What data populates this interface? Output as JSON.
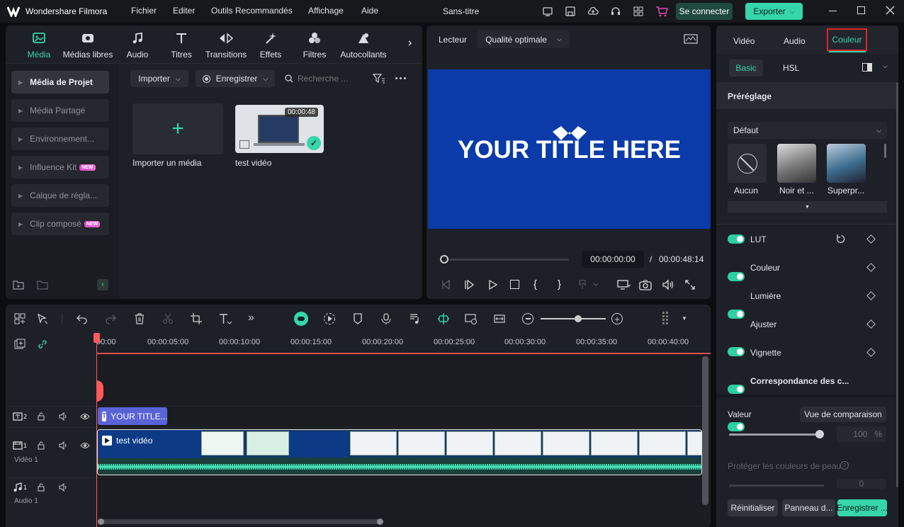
{
  "app": {
    "title": "Wondershare Filmora",
    "project_title": "Sans-titre",
    "login_label": "Se connecter",
    "export_label": "Exporter"
  },
  "menu": [
    "Fichier",
    "Editer",
    "Outils Recommandés",
    "Affichage",
    "Aide"
  ],
  "media_tabs": [
    "Média",
    "Médias libres",
    "Audio",
    "Titres",
    "Transitions",
    "Effets",
    "Filtres",
    "Autocollants"
  ],
  "sidebar": {
    "items": [
      {
        "label": "Média de Projet"
      },
      {
        "label": "Média Partagé"
      },
      {
        "label": "Environnement..."
      },
      {
        "label": "Influence Kit",
        "badge": "NEW"
      },
      {
        "label": "Calque de régla..."
      },
      {
        "label": "Clip composé",
        "badge": "NEW"
      }
    ]
  },
  "media_toolbar": {
    "import_label": "Importer",
    "record_label": "Enregistrer",
    "search_placeholder": "Recherche ..."
  },
  "media_items": [
    {
      "label": "Importer un média"
    },
    {
      "label": "test vidéo",
      "duration": "00:00:48"
    }
  ],
  "player": {
    "label": "Lecteur",
    "quality": "Qualité optimale",
    "preview_title": "YOUR TITLE HERE",
    "current_time": "00:00:00:00",
    "separator": "/",
    "total_time": "00:00:48:14",
    "bracket_open": "{",
    "bracket_close": "}"
  },
  "right_panel": {
    "tabs": [
      "Vidéo",
      "Audio",
      "Couleur"
    ],
    "subtabs": [
      "Basic",
      "HSL"
    ],
    "preset_title": "Préréglage",
    "preset_select": "Défaut",
    "presets": [
      "Aucun",
      "Noir et ...",
      "Superpr..."
    ],
    "toggles": [
      "LUT",
      "Couleur",
      "Lumière",
      "Ajuster",
      "Vignette",
      "Correspondance des c..."
    ],
    "value_label": "Valeur",
    "compare_label": "Vue de comparaison",
    "value": "100",
    "value_unit": "%",
    "skin_label": "Protéger les couleurs de peau",
    "skin_value": "0",
    "buttons": {
      "reset": "Réinitialiser",
      "panel": "Panneau d...",
      "save": "Enregistrer ..."
    }
  },
  "timeline": {
    "ruler": [
      "00:00",
      "00:00:05:00",
      "00:00:10:00",
      "00:00:15:00",
      "00:00:20:00",
      "00:00:25:00",
      "00:00:30:00",
      "00:00:35:00",
      "00:00:40:00"
    ],
    "tracks": {
      "title_num": "2",
      "video_num": "1",
      "video_label": "Vidéo 1",
      "audio_num": "1",
      "audio_label": "Audio 1"
    },
    "title_clip": "YOUR TITLE...",
    "video_clip": "test vidéo"
  },
  "colors": {
    "accent": "#2ecfa0",
    "preview_bg": "#0a3ba8",
    "title_clip": "#5a63d6",
    "playhead": "#ff5a5a",
    "highlight": "#e0242b"
  }
}
